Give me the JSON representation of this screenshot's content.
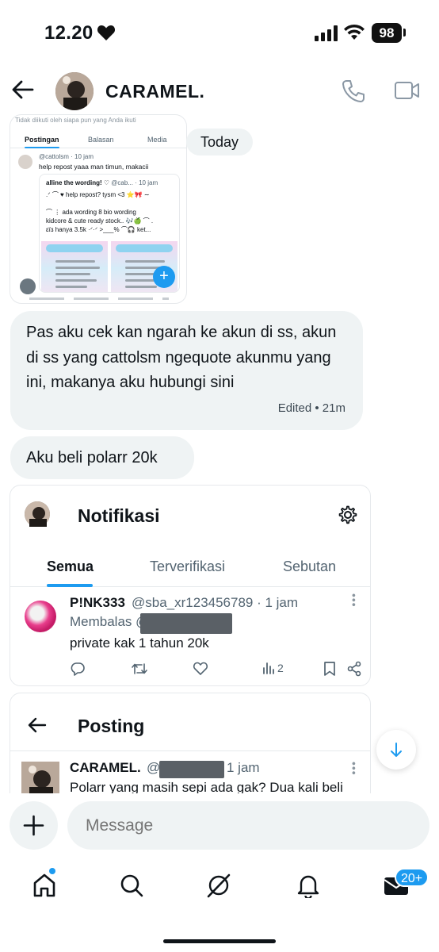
{
  "status_bar": {
    "time": "12.20",
    "battery": "98"
  },
  "header": {
    "contact_name": "CARAMEL."
  },
  "shared_screenshot": {
    "info": "Tidak diikuti oleh siapa pun yang Anda ikuti",
    "tabs": [
      "Postingan",
      "Balasan",
      "Media"
    ],
    "handle": "@cattolsm · 10 jam",
    "text": "help repost yaaa man timun, makacii",
    "quote_name": "alline the wording! ♡",
    "quote_meta": "@cab... · 10 jam",
    "quote_lines": [
      ".ᐟ ⌒ ♥ help repost? tysm <3 ⭐🎀 ∼",
      "⌒ ⋮ ada wording 8 bio wording",
      "kidcore & cute ready stock.. 🎶🍏 ⌒ .",
      "ɛïɜ hanya 3.5k ·ᐟ·ᐟ >___% ⌒🎧 ket..."
    ],
    "fab": "+"
  },
  "date_divider": "Today",
  "messages": [
    {
      "text": "Pas aku cek kan ngarah ke akun di ss, akun di ss yang cattolsm ngequote akunmu yang ini, makanya aku hubungi sini",
      "meta": "Edited • 21m"
    },
    {
      "text": "Aku beli polarr 20k"
    }
  ],
  "notif_card": {
    "title": "Notifikasi",
    "tabs": [
      "Semua",
      "Terverifikasi",
      "Sebutan"
    ],
    "post": {
      "name": "P!NK333",
      "handle": "@sba_xr123456789 · 1 jam",
      "reply_prefix": "Membalas @",
      "text": "private kak 1 tahun 20k",
      "views": "2"
    }
  },
  "post_card": {
    "title": "Posting",
    "name": "CARAMEL.",
    "handle_prefix": "@",
    "time": "1 jam",
    "text": "Polarr yang masih sepi ada gak? Dua kali beli"
  },
  "composer": {
    "placeholder": "Message"
  },
  "tabbar": {
    "messages_badge": "20+"
  },
  "colors": {
    "accent": "#1d9bf0",
    "bubble": "#eff3f4",
    "muted": "#536471"
  }
}
